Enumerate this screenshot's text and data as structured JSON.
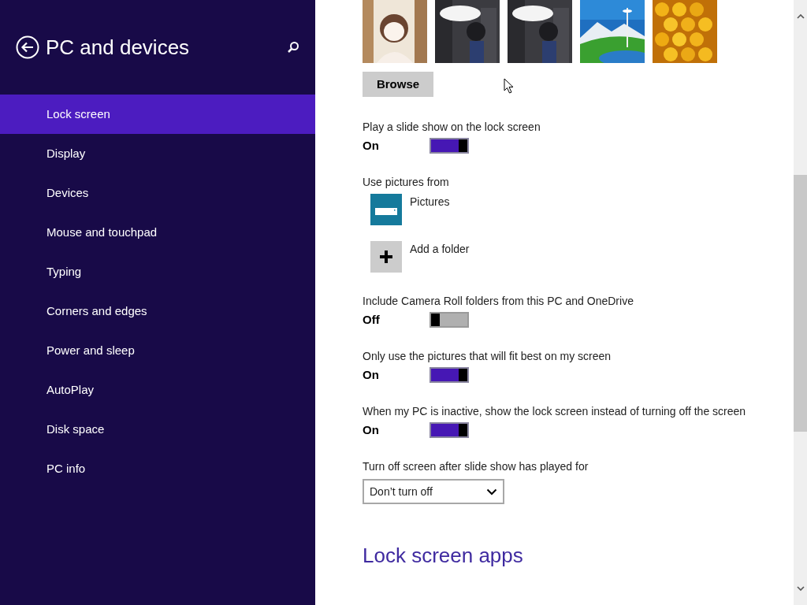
{
  "sidebar": {
    "title": "PC and devices",
    "items": [
      {
        "label": "Lock screen",
        "selected": true
      },
      {
        "label": "Display",
        "selected": false
      },
      {
        "label": "Devices",
        "selected": false
      },
      {
        "label": "Mouse and touchpad",
        "selected": false
      },
      {
        "label": "Typing",
        "selected": false
      },
      {
        "label": "Corners and edges",
        "selected": false
      },
      {
        "label": "Power and sleep",
        "selected": false
      },
      {
        "label": "AutoPlay",
        "selected": false
      },
      {
        "label": "Disk space",
        "selected": false
      },
      {
        "label": "PC info",
        "selected": false
      }
    ]
  },
  "content": {
    "browse_button": "Browse",
    "settings": [
      {
        "kind": "toggle",
        "label": "Play a slide show on the lock screen",
        "state_text": "On",
        "on": true
      },
      {
        "kind": "folders",
        "label": "Use pictures from",
        "folders": [
          {
            "kind": "library",
            "label": "Pictures"
          },
          {
            "kind": "add",
            "label": "Add a folder"
          }
        ]
      },
      {
        "kind": "toggle",
        "label": "Include Camera Roll folders from this PC and OneDrive",
        "state_text": "Off",
        "on": false
      },
      {
        "kind": "toggle",
        "label": "Only use the pictures that will fit best on my screen",
        "state_text": "On",
        "on": true
      },
      {
        "kind": "toggle",
        "label": "When my PC is inactive, show the lock screen instead of turning off the screen",
        "state_text": "On",
        "on": true
      },
      {
        "kind": "dropdown",
        "label": "Turn off screen after slide show has played for",
        "value": "Don’t turn off"
      }
    ],
    "section_heading": "Lock screen apps"
  }
}
